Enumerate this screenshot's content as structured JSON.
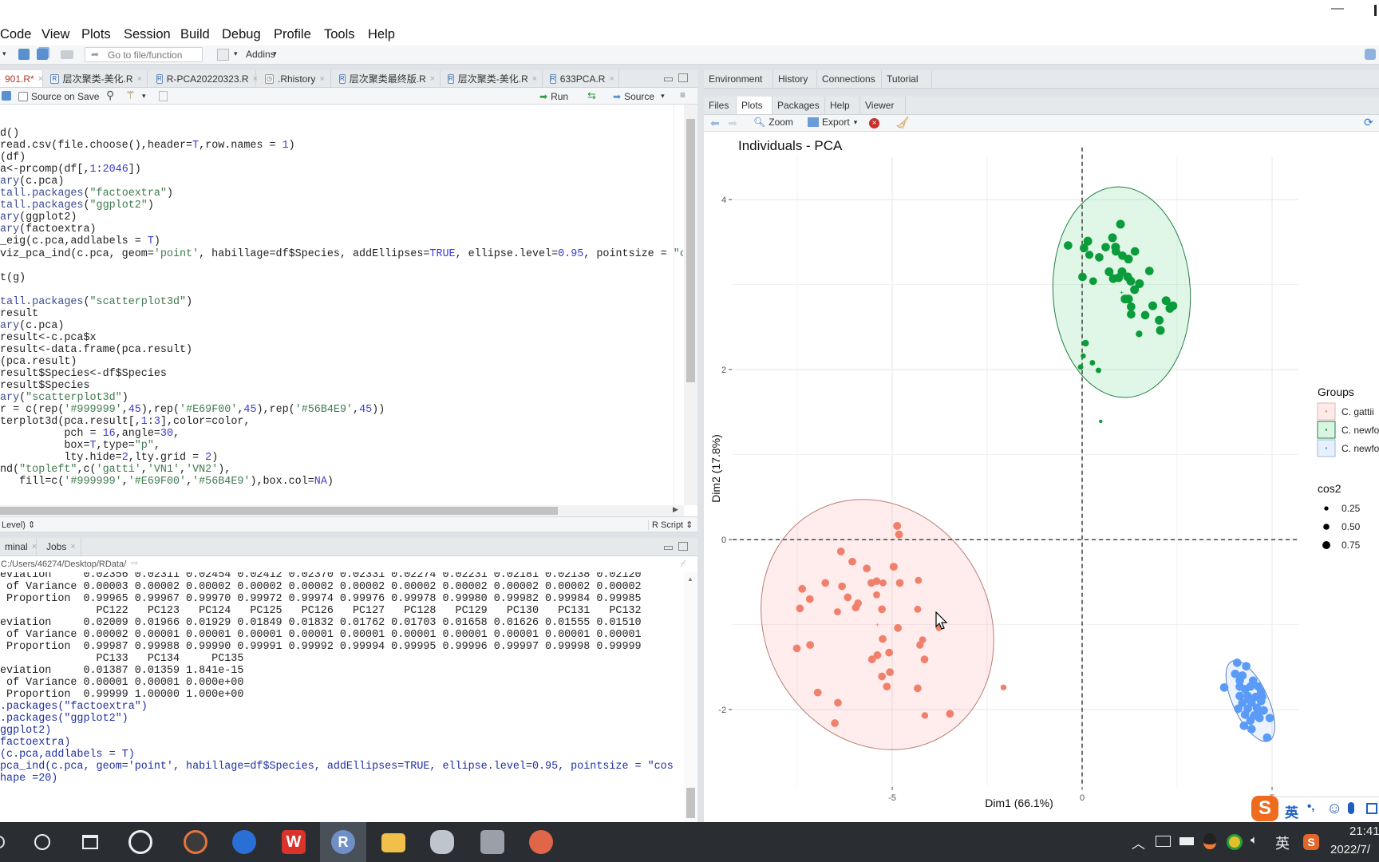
{
  "window": {
    "minimize_glyph": "—"
  },
  "menu": [
    "Code",
    "View",
    "Plots",
    "Session",
    "Build",
    "Debug",
    "Profile",
    "Tools",
    "Help"
  ],
  "toolbar": {
    "goto_placeholder": "Go to file/function",
    "addins": "Addins"
  },
  "editor": {
    "tabs": [
      {
        "label": "901.R*",
        "active": true
      },
      {
        "label": "层次聚类-美化.R"
      },
      {
        "label": "R-PCA20220323.R"
      },
      {
        "label": ".Rhistory"
      },
      {
        "label": "层次聚类最终版.R"
      },
      {
        "label": "层次聚类-美化.R"
      },
      {
        "label": "633PCA.R"
      }
    ],
    "source_on_save": "Source on Save",
    "run": "Run",
    "source": "Source",
    "lines": [
      "d()",
      "read.csv(file.choose(),header=T,row.names = 1)",
      "(df)",
      "a<-prcomp(df[,1:2046])",
      "ary(c.pca)",
      "tall.packages(\"factoextra\")",
      "tall.packages(\"ggplot2\")",
      "ary(ggplot2)",
      "ary(factoextra)",
      "_eig(c.pca,addlabels = T)",
      "viz_pca_ind(c.pca, geom='point', habillage=df$Species, addEllipses=TRUE, ellipse.level=0.95, pointsize = \"c",
      "",
      "t(g)",
      "",
      "tall.packages(\"scatterplot3d\")",
      "result",
      "ary(c.pca)",
      "result<-c.pca$x",
      "result<-data.frame(pca.result)",
      "(pca.result)",
      "result$Species<-df$Species",
      "result$Species",
      "ary(\"scatterplot3d\")",
      "r = c(rep('#999999',45),rep('#E69F00',45),rep('#56B4E9',45))",
      "terplot3d(pca.result[,1:3],color=color,",
      "          pch = 16,angle=30,",
      "          box=T,type=\"p\",",
      "          lty.hide=2,lty.grid = 2)",
      "nd(\"topleft\",c('gatti','VN1','VN2'),",
      "   fill=c('#999999','#E69F00','#56B4E9'),box.col=NA)"
    ],
    "status_left": "Level) ⇕",
    "status_right": "R Script ⇕"
  },
  "console": {
    "tabs": [
      "minal",
      "Jobs"
    ],
    "path": "C:/Users/46274/Desktop/RData/",
    "lines": [
      {
        "t": "eviation     0.02356 0.02311 0.02454 0.02412 0.02370 0.02331 0.02274 0.02231 0.02181 0.02138 0.02120",
        "k": "out"
      },
      {
        "t": " of Variance 0.00003 0.00002 0.00002 0.00002 0.00002 0.00002 0.00002 0.00002 0.00002 0.00002 0.00002",
        "k": "out"
      },
      {
        "t": " Proportion  0.99965 0.99967 0.99970 0.99972 0.99974 0.99976 0.99978 0.99980 0.99982 0.99984 0.99985",
        "k": "out"
      },
      {
        "t": "               PC122   PC123   PC124   PC125   PC126   PC127   PC128   PC129   PC130   PC131   PC132",
        "k": "out"
      },
      {
        "t": "eviation     0.02009 0.01966 0.01929 0.01849 0.01832 0.01762 0.01703 0.01658 0.01626 0.01555 0.01510",
        "k": "out"
      },
      {
        "t": " of Variance 0.00002 0.00001 0.00001 0.00001 0.00001 0.00001 0.00001 0.00001 0.00001 0.00001 0.00001",
        "k": "out"
      },
      {
        "t": " Proportion  0.99987 0.99988 0.99990 0.99991 0.99992 0.99994 0.99995 0.99996 0.99997 0.99998 0.99999",
        "k": "out"
      },
      {
        "t": "               PC133   PC134     PC135",
        "k": "out"
      },
      {
        "t": "eviation     0.01387 0.01359 1.841e-15",
        "k": "out"
      },
      {
        "t": " of Variance 0.00001 0.00001 0.000e+00",
        "k": "out"
      },
      {
        "t": " Proportion  0.99999 1.00000 1.000e+00",
        "k": "out"
      },
      {
        "t": ".packages(\"factoextra\")",
        "k": "cmd"
      },
      {
        "t": ".packages(\"ggplot2\")",
        "k": "cmd"
      },
      {
        "t": "ggplot2)",
        "k": "cmd"
      },
      {
        "t": "factoextra)",
        "k": "cmd"
      },
      {
        "t": "(c.pca,addlabels = T)",
        "k": "cmd"
      },
      {
        "t": "pca_ind(c.pca, geom='point', habillage=df$Species, addEllipses=TRUE, ellipse.level=0.95, pointsize = \"cos",
        "k": "cmd"
      },
      {
        "t": "hape =20)",
        "k": "cmd"
      }
    ]
  },
  "env_tabs": [
    "Environment",
    "History",
    "Connections",
    "Tutorial"
  ],
  "files_tabs": [
    {
      "label": "Files"
    },
    {
      "label": "Plots",
      "active": true
    },
    {
      "label": "Packages"
    },
    {
      "label": "Help"
    },
    {
      "label": "Viewer"
    }
  ],
  "plot_toolbar": {
    "zoom": "Zoom",
    "export": "Export"
  },
  "chart_data": {
    "type": "scatter",
    "title": "Individuals - PCA",
    "xlabel": "Dim1 (66.1%)",
    "ylabel": "Dim2 (17.8%)",
    "xlim": [
      -9.2,
      5.7
    ],
    "ylim": [
      -2.9,
      4.5
    ],
    "xticks": [
      -5,
      0,
      5
    ],
    "yticks": [
      -2,
      0,
      2,
      4
    ],
    "grid": true,
    "reference_lines": {
      "x": 0,
      "y": 0,
      "style": "dashed"
    },
    "legend_position": "right",
    "legend": {
      "groups_title": "Groups",
      "size_title": "cos2",
      "size_values": [
        0.25,
        0.5,
        0.75
      ]
    },
    "series": [
      {
        "name": "C. gattii",
        "color": "#F0806C",
        "mean": [
          -5.39,
          -1.0
        ],
        "points": [
          [
            -4.87,
            0.16,
            0.63
          ],
          [
            -4.82,
            0.06,
            0.63
          ],
          [
            -6.35,
            -0.14,
            0.6
          ],
          [
            -6.05,
            -0.26,
            0.6
          ],
          [
            -5.67,
            -0.34,
            0.6
          ],
          [
            -4.96,
            -0.32,
            0.63
          ],
          [
            -6.76,
            -0.51,
            0.6
          ],
          [
            -6.32,
            -0.55,
            0.6
          ],
          [
            -7.37,
            -0.58,
            0.6
          ],
          [
            -5.55,
            -0.51,
            0.6
          ],
          [
            -5.41,
            -0.49,
            0.6
          ],
          [
            -5.24,
            -0.51,
            0.5
          ],
          [
            -4.8,
            -0.51,
            0.6
          ],
          [
            -4.31,
            -0.48,
            0.5
          ],
          [
            -7.17,
            -0.7,
            0.6
          ],
          [
            -6.17,
            -0.68,
            0.6
          ],
          [
            -5.41,
            -0.65,
            0.5
          ],
          [
            -5.9,
            -0.75,
            0.6
          ],
          [
            -5.96,
            -0.8,
            0.6
          ],
          [
            -7.43,
            -0.81,
            0.6
          ],
          [
            -6.44,
            -0.85,
            0.5
          ],
          [
            -5.27,
            -0.82,
            0.6
          ],
          [
            -4.33,
            -0.82,
            0.5
          ],
          [
            -4.85,
            -1.04,
            0.6
          ],
          [
            -3.77,
            -1.04,
            0.4
          ],
          [
            -5.25,
            -1.17,
            0.6
          ],
          [
            -4.2,
            -1.18,
            0.5
          ],
          [
            -4.27,
            -1.24,
            0.55
          ],
          [
            -7.51,
            -1.28,
            0.6
          ],
          [
            -7.16,
            -1.24,
            0.6
          ],
          [
            -5.39,
            -1.36,
            0.6
          ],
          [
            -5.53,
            -1.41,
            0.6
          ],
          [
            -5.08,
            -1.33,
            0.6
          ],
          [
            -4.15,
            -1.41,
            0.6
          ],
          [
            -5.06,
            -1.56,
            0.6
          ],
          [
            -5.27,
            -1.61,
            0.6
          ],
          [
            -5.14,
            -1.73,
            0.6
          ],
          [
            -4.33,
            -1.75,
            0.6
          ],
          [
            -6.96,
            -1.8,
            0.6
          ],
          [
            -6.43,
            -1.92,
            0.6
          ],
          [
            -6.51,
            -2.16,
            0.6
          ],
          [
            -4.14,
            -2.07,
            0.45
          ],
          [
            -3.48,
            -2.05,
            0.6
          ],
          [
            -2.07,
            -1.74,
            0.35
          ]
        ]
      },
      {
        "name": "C. newfo",
        "color": "#0A9B3A",
        "mean": [
          1.04,
          2.91
        ],
        "points": [
          [
            1.01,
            3.71,
            0.74
          ],
          [
            -0.37,
            3.46,
            0.7
          ],
          [
            0.15,
            3.51,
            0.74
          ],
          [
            0.05,
            3.43,
            0.7
          ],
          [
            0.8,
            3.55,
            0.74
          ],
          [
            0.62,
            3.44,
            0.7
          ],
          [
            0.88,
            3.44,
            0.74
          ],
          [
            0.89,
            3.39,
            0.7
          ],
          [
            0.19,
            3.35,
            0.65
          ],
          [
            0.45,
            3.32,
            0.7
          ],
          [
            1.06,
            3.34,
            0.7
          ],
          [
            1.22,
            3.3,
            0.74
          ],
          [
            1.39,
            3.39,
            0.7
          ],
          [
            1.77,
            3.16,
            0.7
          ],
          [
            0.71,
            3.15,
            0.74
          ],
          [
            0.82,
            3.07,
            0.74
          ],
          [
            1.05,
            3.15,
            0.74
          ],
          [
            0.96,
            3.08,
            0.74
          ],
          [
            1.2,
            3.09,
            0.74
          ],
          [
            1.28,
            3.04,
            0.74
          ],
          [
            0.01,
            3.09,
            0.7
          ],
          [
            0.29,
            3.04,
            0.6
          ],
          [
            1.51,
            3.01,
            0.74
          ],
          [
            1.38,
            2.94,
            0.74
          ],
          [
            1.13,
            2.83,
            0.74
          ],
          [
            1.22,
            2.83,
            0.74
          ],
          [
            1.29,
            2.74,
            0.7
          ],
          [
            1.29,
            2.65,
            0.7
          ],
          [
            1.66,
            2.64,
            0.7
          ],
          [
            1.86,
            2.75,
            0.74
          ],
          [
            2.21,
            2.81,
            0.74
          ],
          [
            2.39,
            2.75,
            0.74
          ],
          [
            2.31,
            2.72,
            0.74
          ],
          [
            2.03,
            2.58,
            0.74
          ],
          [
            2.06,
            2.46,
            0.74
          ],
          [
            1.5,
            2.42,
            0.45
          ],
          [
            0.09,
            2.31,
            0.45
          ],
          [
            0.03,
            2.16,
            0.25
          ],
          [
            0.27,
            2.08,
            0.3
          ],
          [
            -0.04,
            2.03,
            0.3
          ],
          [
            0.43,
            1.99,
            0.3
          ],
          [
            0.49,
            1.39,
            0.02
          ]
        ]
      },
      {
        "name": "C. newfo",
        "color": "#5B9BF8",
        "mean": [
          4.43,
          -1.9
        ],
        "points": [
          [
            4.08,
            -1.45,
            0.7
          ],
          [
            4.32,
            -1.49,
            0.7
          ],
          [
            4.03,
            -1.58,
            0.7
          ],
          [
            4.22,
            -1.6,
            0.7
          ],
          [
            3.74,
            -1.74,
            0.7
          ],
          [
            4.94,
            -2.1,
            0.7
          ],
          [
            4.26,
            -2.19,
            0.7
          ],
          [
            4.46,
            -2.23,
            0.7
          ],
          [
            4.87,
            -2.33,
            0.7
          ],
          [
            4.15,
            -1.73,
            0.7
          ],
          [
            4.29,
            -1.76,
            0.7
          ],
          [
            4.43,
            -1.73,
            0.7
          ],
          [
            4.64,
            -1.73,
            0.7
          ],
          [
            4.71,
            -1.79,
            0.7
          ],
          [
            4.15,
            -1.84,
            0.7
          ],
          [
            4.36,
            -1.84,
            0.7
          ],
          [
            4.57,
            -1.85,
            0.7
          ],
          [
            4.22,
            -1.92,
            0.7
          ],
          [
            4.46,
            -1.92,
            0.7
          ],
          [
            4.71,
            -1.9,
            0.7
          ],
          [
            4.11,
            -1.99,
            0.7
          ],
          [
            4.36,
            -1.99,
            0.7
          ],
          [
            4.6,
            -1.98,
            0.7
          ],
          [
            4.78,
            -2.01,
            0.7
          ],
          [
            4.29,
            -2.06,
            0.7
          ],
          [
            4.53,
            -2.07,
            0.7
          ],
          [
            4.67,
            -2.1,
            0.7
          ],
          [
            4.43,
            -2.13,
            0.7
          ],
          [
            4.15,
            -1.66,
            0.7
          ],
          [
            4.5,
            -1.66,
            0.7
          ],
          [
            4.74,
            -1.85,
            0.7
          ],
          [
            4.64,
            -2.04,
            0.7
          ],
          [
            4.39,
            -1.88,
            0.7
          ]
        ]
      }
    ]
  },
  "ime_bar": {
    "lang": "英",
    "punct": "•,"
  },
  "taskbar": {
    "ime": "英",
    "time": "21:41",
    "date": "2022/7/"
  }
}
